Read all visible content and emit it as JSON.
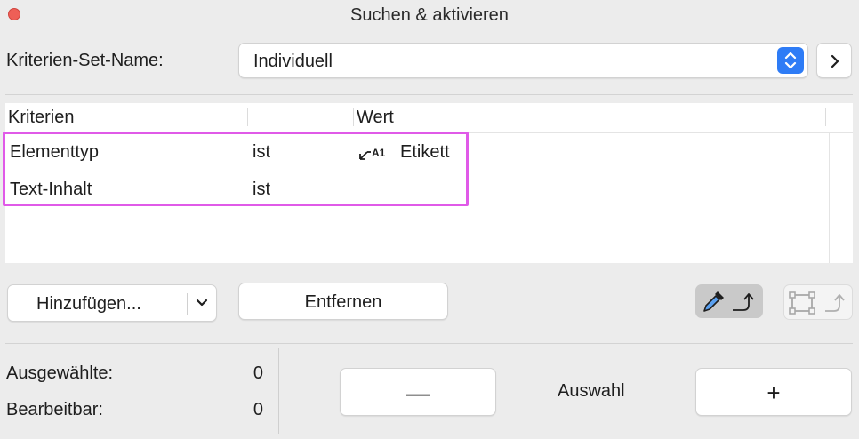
{
  "window": {
    "title": "Suchen & aktivieren"
  },
  "criteria_set": {
    "label": "Kriterien-Set-Name:",
    "value": "Individuell"
  },
  "table": {
    "headers": [
      "Kriterien",
      "",
      "Wert"
    ],
    "rows": [
      {
        "criterion": "Elementtyp",
        "operator": "ist",
        "value": "Etikett",
        "value_icon": "label-tool-icon"
      },
      {
        "criterion": "Text-Inhalt",
        "operator": "ist",
        "value": ""
      }
    ],
    "highlight_color": "#e05ae8"
  },
  "buttons": {
    "add": "Hinzufügen...",
    "remove": "Entfernen",
    "minus": "—",
    "plus": "+"
  },
  "stats": {
    "selected_label": "Ausgewählte:",
    "selected_value": "0",
    "editable_label": "Bearbeitbar:",
    "editable_value": "0"
  },
  "selection_label": "Auswahl",
  "colors": {
    "accent": "#2e7cf6",
    "close": "#ee5f57"
  }
}
